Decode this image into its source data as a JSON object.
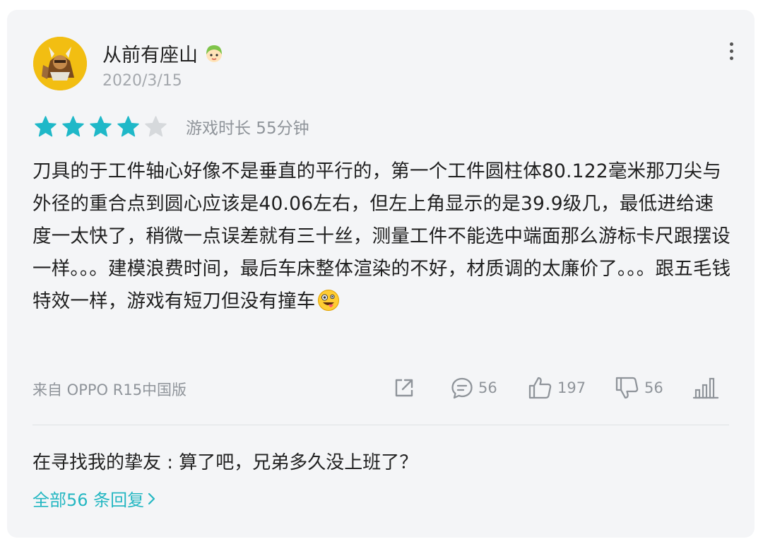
{
  "user": {
    "name": "从前有座山",
    "date": "2020/3/15",
    "avatar_icon": "warrior-avatar-icon",
    "badge_icon": "girl-badge-icon"
  },
  "rating": {
    "stars_filled": 4,
    "stars_total": 5,
    "filled_color": "#1fb8c8",
    "empty_color": "#d6d9dc",
    "playtime": "游戏时长 55分钟"
  },
  "review": {
    "text": "刀具的于工件轴心好像不是垂直的平行的，第一个工件圆柱体80.122毫米那刀尖与外径的重合点到圆心应该是40.06左右，但左上角显示的是39.9级几，最低进给速度一太快了，稍微一点误差就有三十丝，测量工件不能选中端面那么游标卡尺跟摆设一样。。。建模浪费时间，最后车床整体渲染的不好，材质调的太廉价了。。。跟五毛钱特效一样，游戏有短刀但没有撞车",
    "trailing_emoji": "crazy-face-emoji"
  },
  "device": "来自 OPPO R15中国版",
  "actions": {
    "comments": "56",
    "likes": "197",
    "dislikes": "56"
  },
  "reply": {
    "text": "在寻找我的挚友 : 算了吧，兄弟多久没上班了？",
    "all_replies_label": "全部56 条回复",
    "accent_color": "#25b7c2"
  }
}
